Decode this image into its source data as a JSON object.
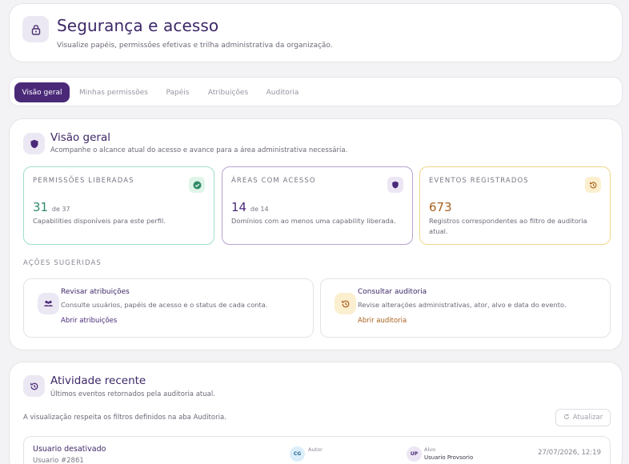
{
  "header": {
    "title": "Segurança e acesso",
    "subtitle": "Visualize papéis, permissões efetivas e trilha administrativa da organização.",
    "icon": "lock-icon"
  },
  "tabs": [
    {
      "label": "Visão geral",
      "active": true
    },
    {
      "label": "Minhas permissões",
      "active": false
    },
    {
      "label": "Papéis",
      "active": false
    },
    {
      "label": "Atribuições",
      "active": false
    },
    {
      "label": "Auditoria",
      "active": false
    }
  ],
  "overview": {
    "icon": "shield-icon",
    "title": "Visão geral",
    "subtitle": "Acompanhe o alcance atual do acesso e avance para a área administrativa necessária.",
    "stats": [
      {
        "label": "PERMISSÕES LIBERADAS",
        "value": "31",
        "of": "de 37",
        "desc": "Capabilities disponíveis para este perfil.",
        "icon": "check-circle-icon",
        "color": "#3f9a77",
        "border": "#9fe0c7",
        "badge_bg": "#dff5ea"
      },
      {
        "label": "ÁREAS COM ACESSO",
        "value": "14",
        "of": "de 14",
        "desc": "Domínios com ao menos uma capability liberada.",
        "icon": "shield-icon",
        "color": "#4a2a78",
        "border": "#b7a3d4",
        "badge_bg": "#ece6f4"
      },
      {
        "label": "EVENTOS REGISTRADOS",
        "value": "673",
        "of": "",
        "desc": "Registros correspondentes ao filtro de auditoria atual.",
        "icon": "history-icon",
        "color": "#a8611e",
        "border": "#f2d58c",
        "badge_bg": "#fbefcf"
      }
    ],
    "actions_label": "AÇÕES SUGERIDAS",
    "actions": [
      {
        "title": "Revisar atribuições",
        "desc": "Consulte usuários, papéis de acesso e o status de cada conta.",
        "link": "Abrir atribuições",
        "icon": "users-icon",
        "link_color": "#4a2a78",
        "icon_bg": "#ece8f3"
      },
      {
        "title": "Consultar auditoria",
        "desc": "Revise alterações administrativas, ator, alvo e data do evento.",
        "link": "Abrir auditoria",
        "icon": "history-icon",
        "link_color": "#a8611e",
        "icon_bg": "#fbefcf"
      }
    ]
  },
  "activity": {
    "icon": "history-icon",
    "title": "Atividade recente",
    "subtitle": "Últimos eventos retornados pela auditoria atual.",
    "note": "A visualização respeita os filtros definidos na aba Auditoria.",
    "refresh_label": "Atualizar",
    "events": [
      {
        "title": "Usuario desativado",
        "subtitle": "Usuario #2861",
        "actor_initials": "CG",
        "actor_label": "Autor",
        "target_initials": "UP",
        "target_label": "Alvo",
        "target_value": "Usuario Provsorio",
        "date": "27/07/2026, 12:19"
      }
    ]
  }
}
